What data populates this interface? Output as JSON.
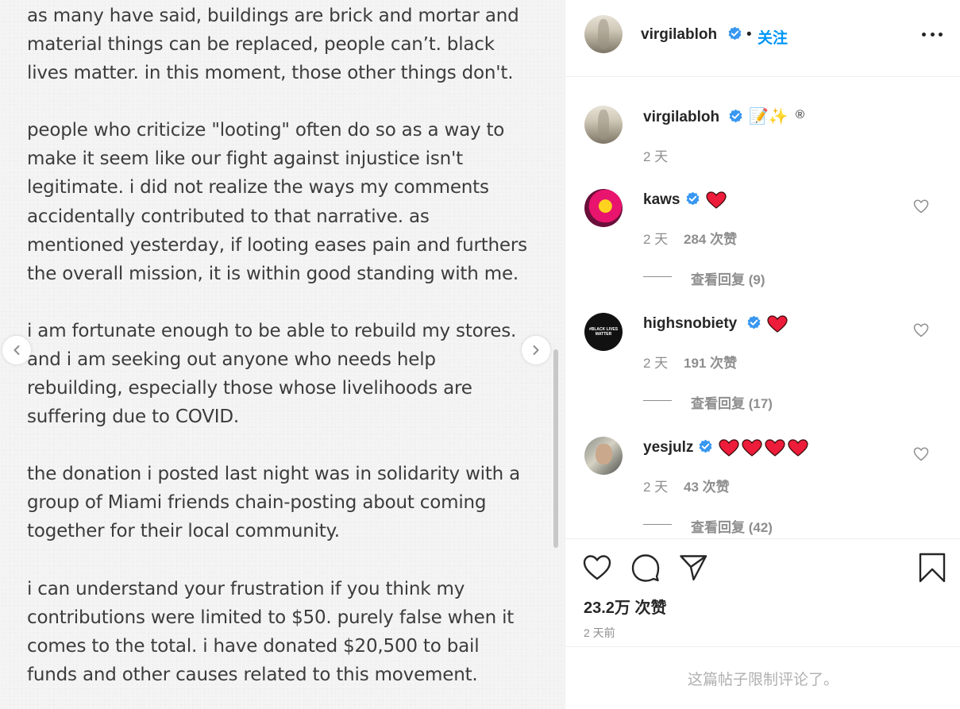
{
  "post_image": {
    "paragraphs": [
      [
        "as many have said, buildings are brick and mortar and",
        "material things can be replaced, people can’t. black",
        "lives matter. in this moment, those other things don't."
      ],
      [
        "people who criticize \"looting\" often do so as a way to",
        "make it seem like our fight against injustice isn't",
        "legitimate. i did not realize the ways my comments",
        "accidentally contributed to that narrative. as",
        "mentioned yesterday, if looting eases pain and furthers",
        "the overall mission, it is within good standing with me."
      ],
      [
        "i am fortunate enough to be able to rebuild my stores.",
        "and i am seeking out anyone who needs help",
        "rebuilding, especially those whose livelihoods are",
        "suffering due to COVID."
      ],
      [
        "the donation i posted last night was in solidarity with a",
        "group of Miami friends chain-posting about coming",
        "together for their local community."
      ],
      [
        "i can understand your frustration if you think my",
        "contributions were limited to $50. purely false when it",
        "comes to the total. i have donated $20,500 to bail",
        "funds and other causes related to this movement."
      ]
    ]
  },
  "header": {
    "username": "virgilabloh",
    "dot": "•",
    "follow_label": "关注"
  },
  "caption": {
    "username": "virgilabloh",
    "text_emoji": "📝✨",
    "registered": "®",
    "time": "2 天"
  },
  "comments": [
    {
      "username": "kaws",
      "time": "2 天",
      "likes": "284 次赞",
      "replies": "查看回复 (9)",
      "hearts": 1
    },
    {
      "username": "highsnobiety",
      "time": "2 天",
      "likes": "191 次赞",
      "replies": "查看回复 (17)",
      "hearts": 1,
      "avatar_text": "#BLACK LIVES MATTER"
    },
    {
      "username": "yesjulz",
      "time": "2 天",
      "likes": "43 次赞",
      "replies": "查看回复 (42)",
      "hearts": 4
    }
  ],
  "footer": {
    "likes_total": "23.2万 次赞",
    "post_time": "2 天前",
    "comments_limited": "这篇帖子限制评论了。"
  },
  "colors": {
    "accent": "#0095f6",
    "verified": "#3897f0",
    "heart_red": "#ed4956",
    "muted": "#8e8e8e"
  }
}
